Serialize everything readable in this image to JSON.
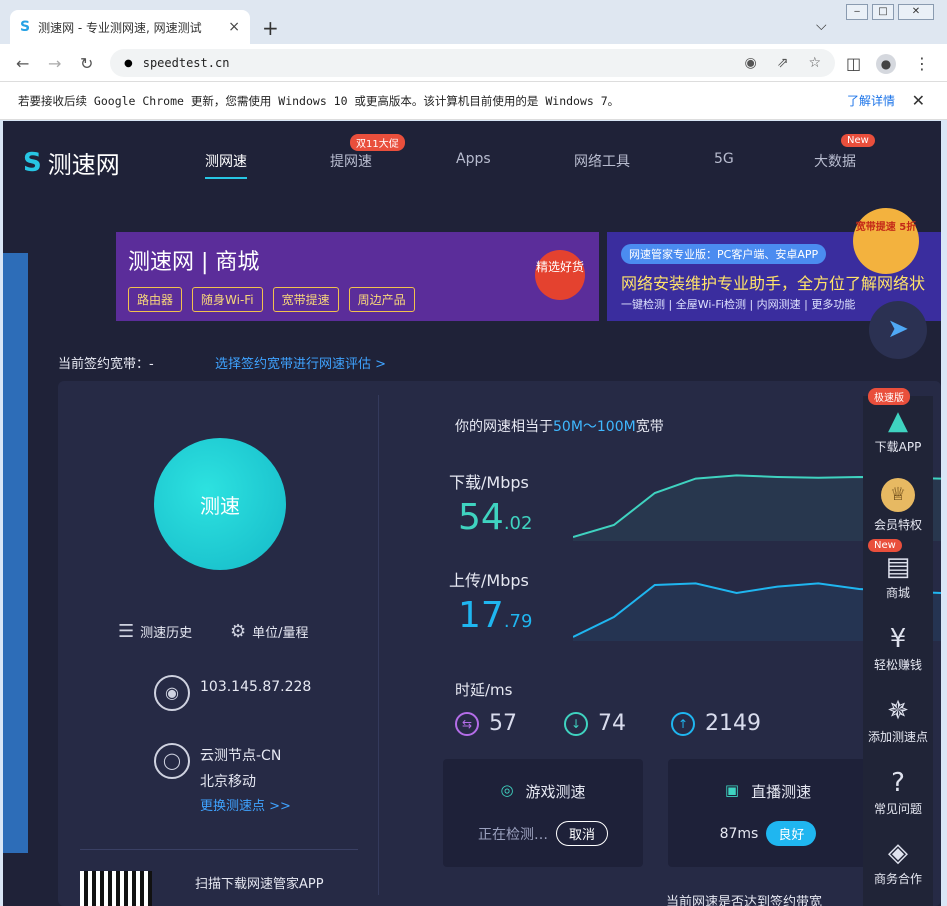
{
  "browser": {
    "tab_title": "测速网 - 专业测网速, 网速测试",
    "tab_close": "×",
    "new_tab": "+",
    "tab_list": "⌵",
    "win_min": "‒",
    "win_max": "□",
    "win_close": "✕",
    "back": "←",
    "forward": "→",
    "reload": "↻",
    "lock": "🔒",
    "url": "speedtest.cn",
    "menu": "⋮"
  },
  "infobar": {
    "message": "若要接收后续 Google Chrome 更新，您需使用 Windows 10 或更高版本。该计算机目前使用的是 Windows 7。",
    "link": "了解详情",
    "close": "✕"
  },
  "site": {
    "logo": "测速网",
    "nav": [
      {
        "label": "测网速"
      },
      {
        "label": "提网速",
        "badge": "双11大促"
      },
      {
        "label": "Apps"
      },
      {
        "label": "网络工具"
      },
      {
        "label": "5G"
      },
      {
        "label": "大数据",
        "badge": "New"
      }
    ],
    "banner1": {
      "title": "测速网 | 商城",
      "chips": [
        "路由器",
        "随身Wi-Fi",
        "宽带提速",
        "周边产品"
      ],
      "seal": "精选好货"
    },
    "banner2": {
      "pill": "网速管家专业版：PC客户端、安卓APP",
      "headline": "网络安装维护专业助手，全方位了解网络状",
      "sub": "一键检测 | 全屋Wi-Fi检测 | 内网测速 | 更多功能",
      "badge": "宽带提速 5折"
    },
    "signed_label": "当前签约宽带：-",
    "signed_link": "选择签约宽带进行网速评估 >",
    "test_button": "测速",
    "history": "测速历史",
    "units": "单位/量程",
    "ip": "103.145.87.228",
    "server_node": "云测节点-CN",
    "isp": "北京移动",
    "change_server": "更换测速点 >>",
    "qr_text": "扫描下载网速管家APP",
    "equivalent": {
      "prefix": "你的网速相当于",
      "range": "50M～100M",
      "suffix": "宽带"
    },
    "download": {
      "label": "下载/Mbps",
      "int": "54",
      "dec": ".02"
    },
    "upload": {
      "label": "上传/Mbps",
      "int": "17",
      "dec": ".79"
    },
    "latency": {
      "label": "时延/ms",
      "values": [
        "57",
        "74",
        "2149"
      ]
    },
    "game": {
      "title": "游戏测速",
      "status": "正在检测…",
      "button": "取消"
    },
    "live": {
      "title": "直播测速",
      "ms": "87ms",
      "rating": "良好"
    },
    "bottom_text": "当前网速是否达到签约带宽",
    "rail": [
      {
        "label": "下载APP",
        "badge": "极速版"
      },
      {
        "label": "会员特权"
      },
      {
        "label": "商城",
        "badge": "New"
      },
      {
        "label": "轻松赚钱"
      },
      {
        "label": "添加测速点"
      },
      {
        "label": "常见问题"
      },
      {
        "label": "商务合作"
      }
    ]
  },
  "colors": {
    "page_bg": "#1f2238",
    "accent": "#27c6e4",
    "download_line": "#3fd3c0",
    "upload_line": "#1fb6f0"
  },
  "chart_data": {
    "type": "line",
    "series": [
      {
        "values": [
          0.05,
          0.2,
          0.6,
          0.78,
          0.82,
          0.8,
          0.79,
          0.8,
          0.79,
          0.78
        ]
      },
      {
        "values": [
          0.05,
          0.3,
          0.7,
          0.72,
          0.6,
          0.68,
          0.72,
          0.65,
          0.62,
          0.6
        ]
      }
    ]
  }
}
